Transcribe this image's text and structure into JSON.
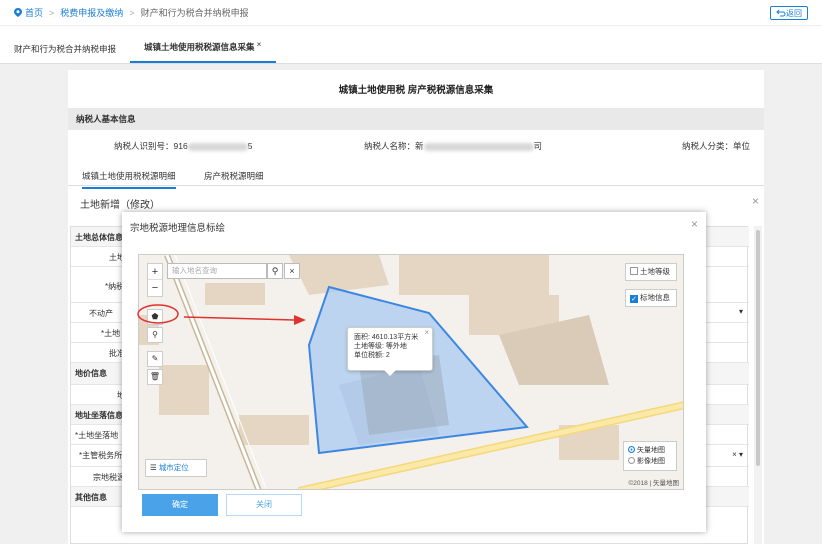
{
  "breadcrumb": {
    "home": "首页",
    "level1": "税费申报及缴纳",
    "level2": "财产和行为税合并纳税申报",
    "sep": ">"
  },
  "back_button": "返回",
  "tabs": [
    {
      "label": "财产和行为税合并纳税申报"
    },
    {
      "label": "城镇土地使用税税源信息采集",
      "close": "×"
    }
  ],
  "sheet": {
    "title": "城镇土地使用税  房产税税源信息采集",
    "basic_info_header": "纳税人基本信息",
    "taxpayer_id_label": "纳税人识别号：",
    "taxpayer_id_start": "916",
    "taxpayer_id_end": "5",
    "taxpayer_name_label": "纳税人名称：",
    "taxpayer_name_start": "新",
    "taxpayer_name_end": "司",
    "taxpayer_type_label": "纳税人分类：",
    "taxpayer_type_value": "单位",
    "subtabs": [
      "城镇土地使用税税源明细",
      "房产税税源明细"
    ]
  },
  "land_form": {
    "title": "土地新增（修改）",
    "rows": [
      {
        "label": "土地总体信息",
        "head": true
      },
      {
        "label": "土地"
      },
      {
        "label": "*纳税"
      },
      {
        "label": "不动产"
      },
      {
        "label": "*土地"
      },
      {
        "label": "批准"
      },
      {
        "label": "地价信息",
        "head": true
      },
      {
        "label": "地"
      },
      {
        "label": "地址坐落信息",
        "head": true
      },
      {
        "label": "*土地坐落地"
      },
      {
        "label": "*主管税务所"
      },
      {
        "label": "宗地税源"
      },
      {
        "label": "其他信息",
        "head": true
      }
    ]
  },
  "modal": {
    "title": "宗地税源地理信息标绘",
    "close": "×",
    "search_placeholder": "输入地名查询",
    "zoom_in": "+",
    "zoom_out": "−",
    "check_land_grade": "土地等级",
    "check_label_info": "标地信息",
    "popup_area": "面积: 4610.13平方米",
    "popup_grade": "土地等级: 等外地",
    "popup_tax": "单位税额: 2",
    "city_locate": "城市定位",
    "layer_vector": "矢量地图",
    "layer_image": "影像地图",
    "copyright": "©2018 | 矢量地图",
    "ok": "确定",
    "cancel": "关闭"
  },
  "colors": {
    "accent": "#1a7fd4",
    "polygon_fill": "#a9c9f0",
    "polygon_stroke": "#3d87e0",
    "annotation_red": "#e0322e"
  }
}
